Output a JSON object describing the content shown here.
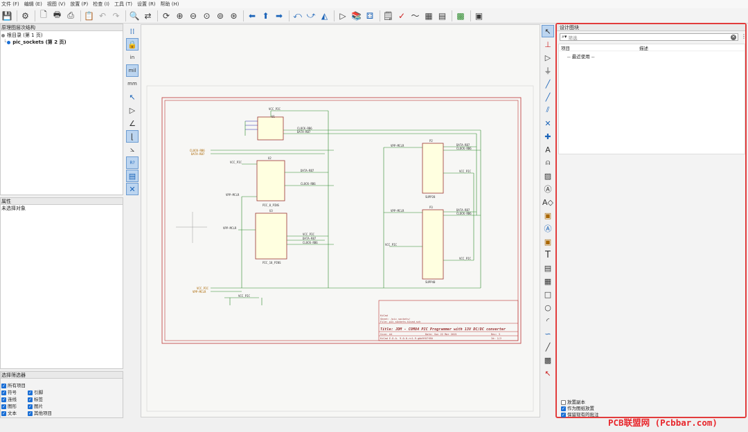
{
  "menu": [
    "文件 (F)",
    "编辑 (E)",
    "视图 (V)",
    "放置 (P)",
    "检查 (I)",
    "工具 (T)",
    "设置 (R)",
    "帮助 (H)"
  ],
  "toolbar_icons": [
    "save-icon",
    "schematic-setup-icon",
    "new-page-icon",
    "print-icon",
    "plot-icon",
    "paste-icon",
    "undo-icon",
    "redo-icon",
    "find-icon",
    "find-replace-icon",
    "refresh-icon",
    "zoom-in-icon",
    "zoom-out-icon",
    "zoom-fit-icon",
    "zoom-objects-icon",
    "zoom-selection-icon",
    "back-icon",
    "up-icon",
    "forward-icon",
    "rotate-ccw-icon",
    "rotate-cw-icon",
    "mirror-icon",
    "symbol-editor-icon",
    "symbol-browser-icon",
    "footprint-assign-icon",
    "annotate-icon",
    "erc-icon",
    "simulator-icon",
    "bom-icon",
    "netlist-icon",
    "pcb-editor-icon",
    "scripting-icon"
  ],
  "hierarchy": {
    "title": "原理图层次结构",
    "root": "根目录 (第 1 页)",
    "child": "pic_sockets (第 2 页)"
  },
  "properties": {
    "title": "属性",
    "empty": "未选择对象"
  },
  "selection_filter": {
    "title": "选择筛选器",
    "items": [
      "所有项目",
      "引脚",
      "符号",
      "标签",
      "连线",
      "图片",
      "图形",
      "其他项目",
      "文本"
    ]
  },
  "design_blocks": {
    "title": "设计图块",
    "filter_placeholder": "筛选",
    "col_item": "项目",
    "col_desc": "描述",
    "recent": "-- 最近使用 --",
    "options": [
      "放置副本",
      "作为图纸放置",
      "保留现有的批注"
    ]
  },
  "schematic": {
    "u1": "U1",
    "u2": "U2",
    "u3": "U3",
    "vcc_pic": "VCC_PIC",
    "vpp_mclr": "VPP-MCLR",
    "vcc_pic2": "VCC_PIC",
    "clock_rb6": "CLOCK-RB6",
    "data_rb7": "DATA-RB7",
    "p2": "P2",
    "p3": "P3",
    "supp28": "SUPP28",
    "supp40": "SUPP40",
    "pic8": "PIC_8_PINS",
    "pic18": "PIC_18_PINS",
    "title_block_title": "Title: JDM - COM84 PIC Programmer with 13V DC/DC converter",
    "sheet": "Sheet: /pic_sockets/",
    "file": "File: pic_sockets.kicad_sch",
    "size": "Size: A4",
    "date": "Date: Sun 22 Mar 2015",
    "rev": "Rev: 3",
    "kicad": "KiCad E.D.A. 9.0.0-rc1-9-gbb9f07f80",
    "id": "Id: 2/2",
    "kicad_label": "KiCad"
  },
  "watermark": "PCB联盟网 (Pcbbar.com)"
}
